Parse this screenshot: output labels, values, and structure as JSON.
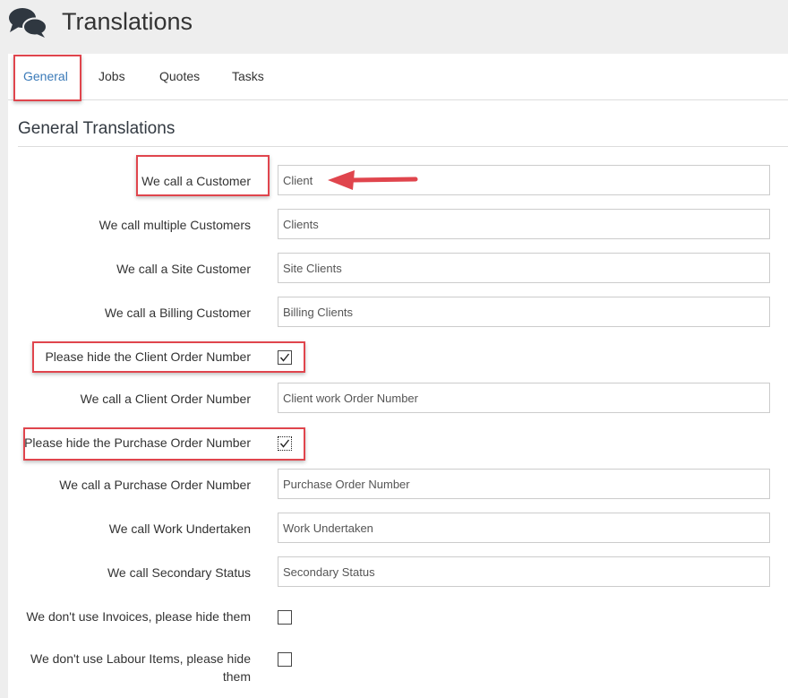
{
  "header": {
    "title": "Translations",
    "icon": "chat-bubbles-icon"
  },
  "tabs": [
    {
      "label": "General",
      "active": true
    },
    {
      "label": "Jobs",
      "active": false
    },
    {
      "label": "Quotes",
      "active": false
    },
    {
      "label": "Tasks",
      "active": false
    }
  ],
  "section": {
    "title": "General Translations"
  },
  "rows": [
    {
      "label": "We call a Customer",
      "type": "text",
      "value": "Client"
    },
    {
      "label": "We call multiple Customers",
      "type": "text",
      "value": "Clients"
    },
    {
      "label": "We call a Site Customer",
      "type": "text",
      "value": "Site Clients"
    },
    {
      "label": "We call a Billing Customer",
      "type": "text",
      "value": "Billing Clients"
    },
    {
      "label": "Please hide the Client Order Number",
      "type": "checkbox",
      "checked": true
    },
    {
      "label": "We call a Client Order Number",
      "type": "text",
      "value": "Client work Order Number"
    },
    {
      "label": "Please hide the Purchase Order Number",
      "type": "checkbox",
      "checked": true
    },
    {
      "label": "We call a Purchase Order Number",
      "type": "text",
      "value": "Purchase Order Number"
    },
    {
      "label": "We call Work Undertaken",
      "type": "text",
      "value": "Work Undertaken"
    },
    {
      "label": "We call Secondary Status",
      "type": "text",
      "value": "Secondary Status"
    },
    {
      "label": "We don't use Invoices, please hide them",
      "type": "checkbox",
      "checked": false
    },
    {
      "label": "We don't use Labour Items, please hide them",
      "type": "checkbox",
      "checked": false
    }
  ],
  "colors": {
    "accent": "#3a7ab8",
    "highlight": "#e0454d",
    "header_bg": "#eeeeee"
  }
}
